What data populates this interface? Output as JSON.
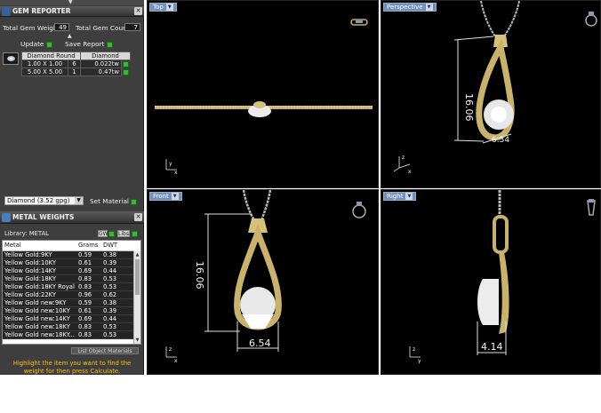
{
  "gem_reporter": {
    "title": "GEM REPORTER",
    "total_weight_label": "Total Gem Weight",
    "total_weight_value": "49",
    "total_count_label": "Total Gem Count",
    "total_count_value": "7",
    "update_label": "Update",
    "save_label": "Save Report",
    "table_headers": [
      "Diamond Round",
      "Diamond"
    ],
    "rows": [
      {
        "size": "1.00 X 1.00",
        "count": "6",
        "weight": "0.022tw"
      },
      {
        "size": "5.00 X 5.00",
        "count": "1",
        "weight": "0.47tw"
      }
    ]
  },
  "material": {
    "dropdown_value": "Diamond   (3.52 gpg)",
    "set_label": "Set Material"
  },
  "metal_weights": {
    "title": "METAL WEIGHTS",
    "library_label": "Library: METAL",
    "btn1": "GW",
    "btn2": "Libs",
    "headers": [
      "Metal",
      "Grams",
      "DWT"
    ],
    "rows": [
      [
        "Yellow Gold:9KY",
        "0.59",
        "0.38"
      ],
      [
        "Yellow Gold:10KY",
        "0.61",
        "0.39"
      ],
      [
        "Yellow Gold:14KY",
        "0.69",
        "0.44"
      ],
      [
        "Yellow Gold:18KY",
        "0.83",
        "0.53"
      ],
      [
        "Yellow Gold:18KY Royal",
        "0.83",
        "0.53"
      ],
      [
        "Yellow Gold:22KY",
        "0.96",
        "0.62"
      ],
      [
        "Yellow Gold new:9KY",
        "0.59",
        "0.38"
      ],
      [
        "Yellow Gold new:10KY",
        "0.61",
        "0.39"
      ],
      [
        "Yellow Gold new:14KY",
        "0.69",
        "0.44"
      ],
      [
        "Yellow Gold new:18KY",
        "0.83",
        "0.53"
      ],
      [
        "Yellow Gold new:18KY...",
        "0.83",
        "0.53"
      ]
    ],
    "list_objects_label": "List Object Materials",
    "hint": "Highlight the item you want to find the weight for then press Calculate."
  },
  "viewports": {
    "top": "Top",
    "perspective": "Perspective",
    "front": "Front",
    "right": "Right"
  },
  "dimensions": {
    "perspective_height": "16.06",
    "perspective_width": "6.54",
    "front_height": "16.06",
    "front_width": "6.54",
    "right_width": "4.14"
  },
  "axis_labels": {
    "x": "x",
    "y": "y",
    "z": "z"
  },
  "colors": {
    "viewport_bg": "#000000",
    "panel_bg": "#3e3e3e",
    "gold": "#c9b26a",
    "hint": "#ffc21a",
    "tag": "#6f8fbf"
  }
}
